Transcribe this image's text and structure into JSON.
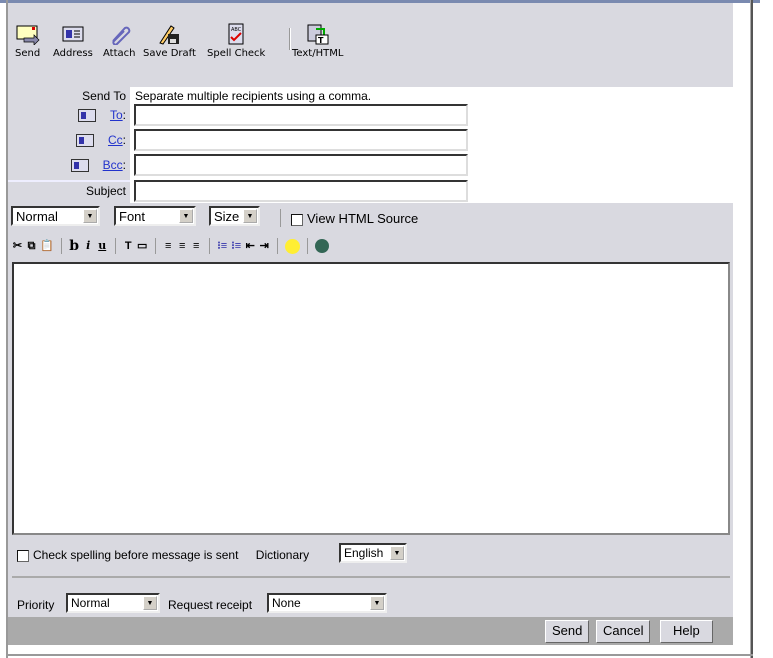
{
  "toolbar": {
    "items": [
      {
        "label": "Send",
        "icon": "send-icon"
      },
      {
        "label": "Address",
        "icon": "address-book-icon"
      },
      {
        "label": "Attach",
        "icon": "paperclip-icon"
      },
      {
        "label": "Save Draft",
        "icon": "save-draft-icon"
      },
      {
        "label": "Spell Check",
        "icon": "spell-check-icon"
      },
      {
        "label": "Text/HTML",
        "icon": "text-html-icon"
      }
    ]
  },
  "recipients": {
    "send_to_label": "Send To",
    "hint": "Separate multiple recipients using a comma.",
    "to_label": "To",
    "cc_label": "Cc",
    "bcc_label": "Bcc",
    "to_value": "",
    "cc_value": "",
    "bcc_value": "",
    "subject_label": "Subject",
    "subject_value": ""
  },
  "format": {
    "style": "Normal",
    "font": "Font",
    "size": "Size",
    "view_source_label": "View HTML Source",
    "view_source_checked": false
  },
  "editor": {
    "body": ""
  },
  "spell": {
    "check_label": "Check spelling before message is sent",
    "checked": false,
    "dictionary_label": "Dictionary",
    "dictionary": "English"
  },
  "options": {
    "priority_label": "Priority",
    "priority": "Normal",
    "receipt_label": "Request receipt",
    "receipt": "None"
  },
  "buttons": {
    "send": "Send",
    "cancel": "Cancel",
    "help": "Help"
  }
}
